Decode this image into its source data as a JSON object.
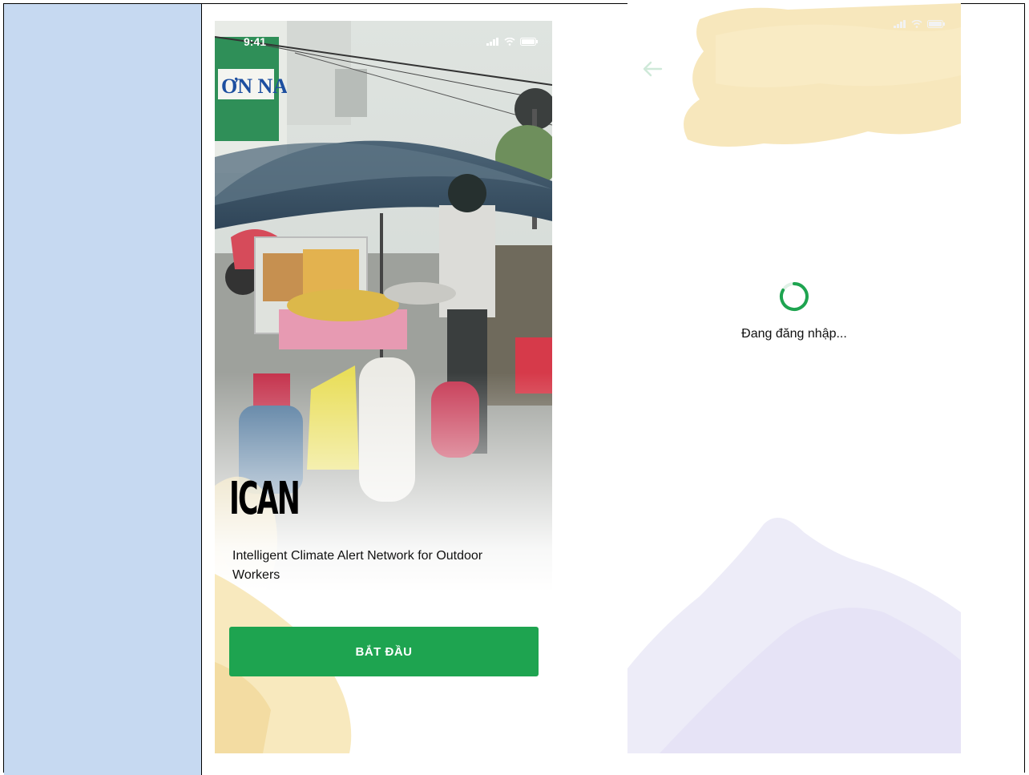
{
  "welcome_screen": {
    "status_time": "9:41",
    "app_name": "ICAN",
    "tagline": "Intelligent Climate Alert Network for Outdoor Workers",
    "start_button_label": "BẮT ĐẦU",
    "accent_color": "#1ea450"
  },
  "login_screen": {
    "loading_text": "Đang đăng nhập...",
    "spinner_color": "#1ea450"
  },
  "icons": {
    "back": "arrow-left-icon",
    "signal": "signal-icon",
    "wifi": "wifi-icon",
    "battery": "battery-icon",
    "loading": "spinner-icon"
  }
}
